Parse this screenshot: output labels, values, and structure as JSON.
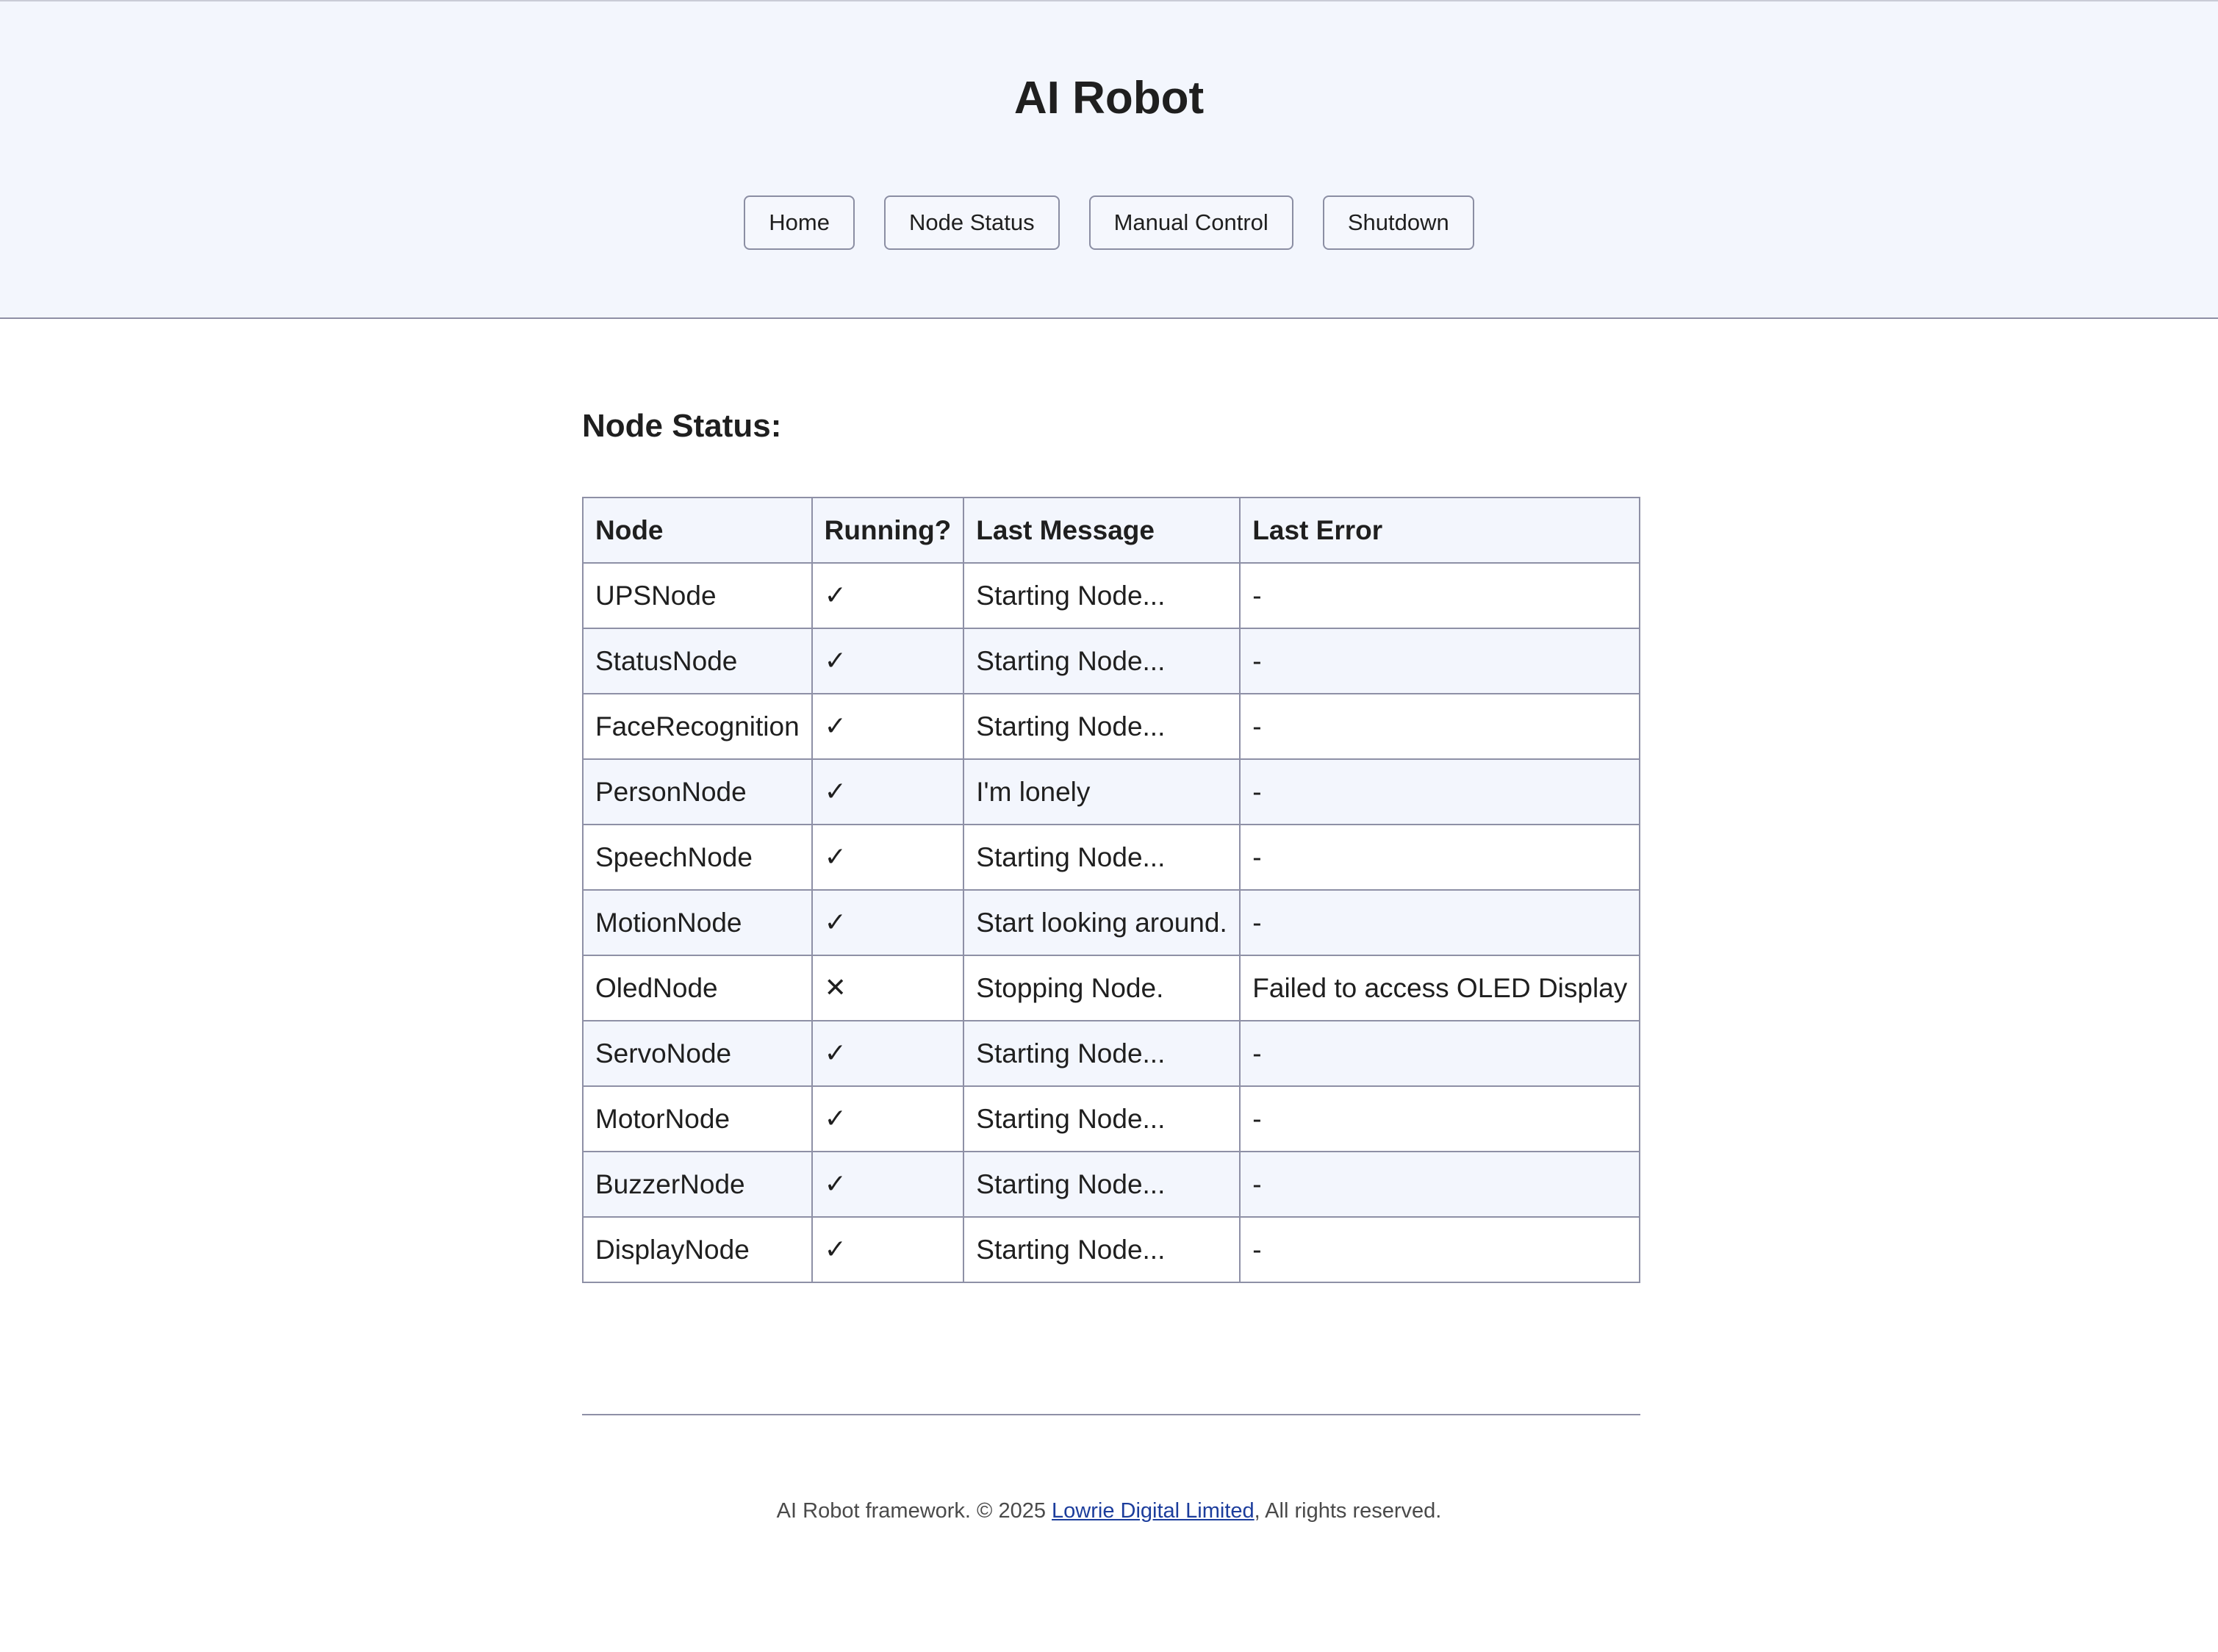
{
  "header": {
    "title": "AI Robot",
    "nav": [
      {
        "label": "Home"
      },
      {
        "label": "Node Status"
      },
      {
        "label": "Manual Control"
      },
      {
        "label": "Shutdown"
      }
    ]
  },
  "main": {
    "section_title": "Node Status:",
    "table": {
      "columns": [
        "Node",
        "Running?",
        "Last Message",
        "Last Error"
      ],
      "rows": [
        {
          "node": "UPSNode",
          "running": "✓",
          "message": "Starting Node...",
          "error": "-"
        },
        {
          "node": "StatusNode",
          "running": "✓",
          "message": "Starting Node...",
          "error": "-"
        },
        {
          "node": "FaceRecognition",
          "running": "✓",
          "message": "Starting Node...",
          "error": "-"
        },
        {
          "node": "PersonNode",
          "running": "✓",
          "message": "I'm lonely",
          "error": "-"
        },
        {
          "node": "SpeechNode",
          "running": "✓",
          "message": "Starting Node...",
          "error": "-"
        },
        {
          "node": "MotionNode",
          "running": "✓",
          "message": "Start looking around.",
          "error": "-"
        },
        {
          "node": "OledNode",
          "running": "✕",
          "message": "Stopping Node.",
          "error": "Failed to access OLED Display"
        },
        {
          "node": "ServoNode",
          "running": "✓",
          "message": "Starting Node...",
          "error": "-"
        },
        {
          "node": "MotorNode",
          "running": "✓",
          "message": "Starting Node...",
          "error": "-"
        },
        {
          "node": "BuzzerNode",
          "running": "✓",
          "message": "Starting Node...",
          "error": "-"
        },
        {
          "node": "DisplayNode",
          "running": "✓",
          "message": "Starting Node...",
          "error": "-"
        }
      ]
    }
  },
  "footer": {
    "text_before": "AI Robot framework. © 2025 ",
    "link_text": "Lowrie Digital Limited",
    "text_after": ", All rights reserved."
  },
  "colors": {
    "header_bg": "#f3f6fd",
    "border": "#8e90a6",
    "link": "#1c3d9c"
  }
}
